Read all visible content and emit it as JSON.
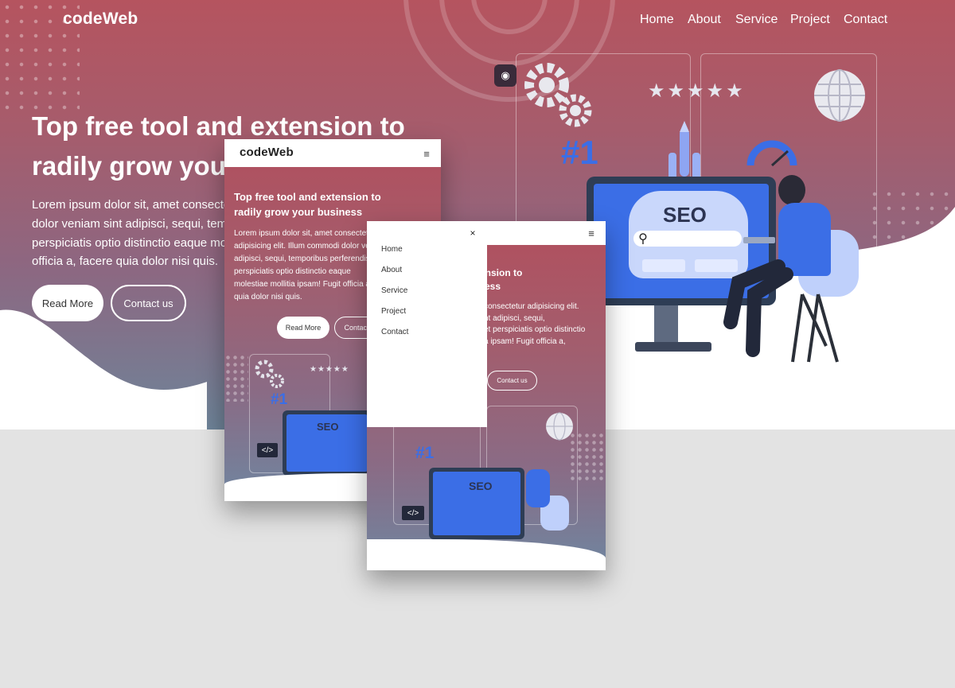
{
  "brand": "codeWeb",
  "nav": [
    "Home",
    "About",
    "Service",
    "Project",
    "Contact"
  ],
  "hero": {
    "title_line1": "Top free tool and extension to",
    "title_line2": "radily grow your business",
    "para_lines": [
      "Lorem ipsum dolor sit, amet consectetur adipisicing elit. Illum commodi",
      "dolor veniam sint adipisci, sequi, temporibus perferendis fugit",
      "perspiciatis optio distinctio eaque molestiae mollitia ipsam! Fugit",
      "officia a, facere quia dolor nisi quis."
    ],
    "read_more": "Read More",
    "contact": "Contact us"
  },
  "tablet": {
    "title_line1": "Top free tool and extension to",
    "title_line2": "radily grow your business",
    "para_lines": [
      "Lorem ipsum dolor sit, amet consectetur",
      "adipisicing elit. Illum commodi dolor veniam",
      "adipisci, sequi, temporibus perferendis fugit",
      "perspiciatis optio distinctio eaque",
      "molestiae mollitia ipsam! Fugit officia a,",
      "quia dolor nisi quis."
    ],
    "read_more": "Read More",
    "contact": "Contact us"
  },
  "mobile": {
    "title_partial_1": "ension to",
    "title_partial_2": "ess",
    "para_lines": [
      "consectetur adipisicing elit.",
      "nt adipisci, sequi,",
      "et perspiciatis optio distinctio",
      "a ipsam! Fugit officia a,"
    ],
    "contact": "Contact us",
    "menu": [
      "Home",
      "About",
      "Service",
      "Project",
      "Contact"
    ],
    "close_glyph": "×"
  },
  "illustration": {
    "seo": "SEO",
    "rank": "#1",
    "code": "</>",
    "stars": "★★★★★"
  },
  "colors": {
    "brand_red": "#b5545f",
    "brand_slate": "#6e8499",
    "accent_blue": "#3b6ee6",
    "white": "#ffffff"
  }
}
